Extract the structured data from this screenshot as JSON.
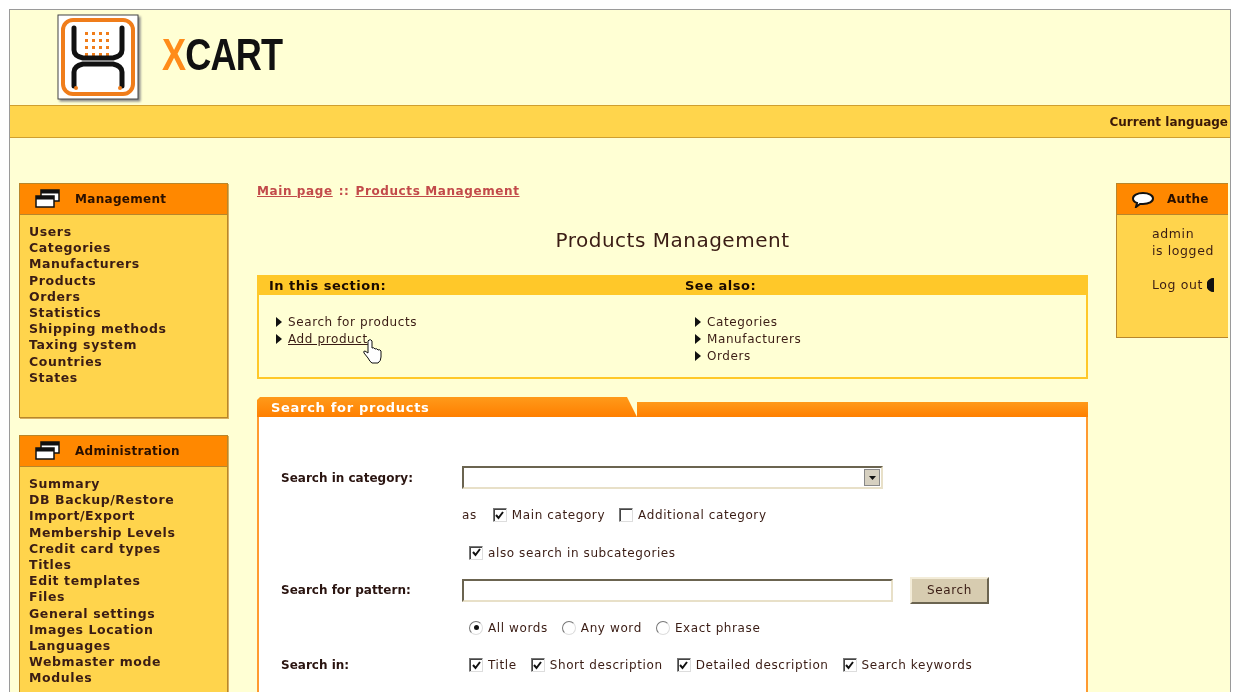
{
  "logo": {
    "parts": [
      {
        "text": "X",
        "color": "#ff8c1a"
      },
      {
        "text": "CART",
        "color": "#111111"
      }
    ]
  },
  "top_bar": {
    "language_label": "Current language"
  },
  "sidebar": [
    {
      "title": "Management",
      "items": [
        "Users",
        "Categories",
        "Manufacturers",
        "Products",
        "Orders",
        "Statistics",
        "Shipping methods",
        "Taxing system",
        "Countries",
        "States"
      ]
    },
    {
      "title": "Administration",
      "items": [
        "Summary",
        "DB Backup/Restore",
        "Import/Export",
        "Membership Levels",
        "Credit card types",
        "Titles",
        "Edit templates",
        "Files",
        "General settings",
        "Images Location",
        "Languages",
        "Webmaster mode",
        "Modules"
      ]
    }
  ],
  "breadcrumb": {
    "links": [
      "Main page",
      "Products Management"
    ],
    "separator": "::"
  },
  "page_title": "Products Management",
  "section_box": {
    "columns": [
      {
        "title": "In this section:",
        "links": [
          {
            "label": "Search for products",
            "hovered": false
          },
          {
            "label": "Add product",
            "hovered": true
          }
        ]
      },
      {
        "title": "See also:",
        "links": [
          {
            "label": "Categories",
            "hovered": false
          },
          {
            "label": "Manufacturers",
            "hovered": false
          },
          {
            "label": "Orders",
            "hovered": false
          }
        ]
      }
    ]
  },
  "search_panel": {
    "title": "Search for products",
    "category": {
      "label": "Search in category:",
      "as_text": "as",
      "options": [
        {
          "label": "Main category",
          "checked": true
        },
        {
          "label": "Additional category",
          "checked": false
        }
      ],
      "subcategories": {
        "label": "also search in subcategories",
        "checked": true
      }
    },
    "pattern": {
      "label": "Search for pattern:",
      "button": "Search",
      "modes": [
        {
          "label": "All words",
          "selected": true
        },
        {
          "label": "Any word",
          "selected": false
        },
        {
          "label": "Exact phrase",
          "selected": false
        }
      ]
    },
    "search_in": {
      "label": "Search in:",
      "options": [
        {
          "label": "Title",
          "checked": true
        },
        {
          "label": "Short description",
          "checked": true
        },
        {
          "label": "Detailed description",
          "checked": true
        },
        {
          "label": "Search keywords",
          "checked": true
        }
      ]
    }
  },
  "auth_panel": {
    "title": "Authe",
    "lines": [
      "admin",
      "is logged"
    ],
    "logout": "Log out"
  }
}
